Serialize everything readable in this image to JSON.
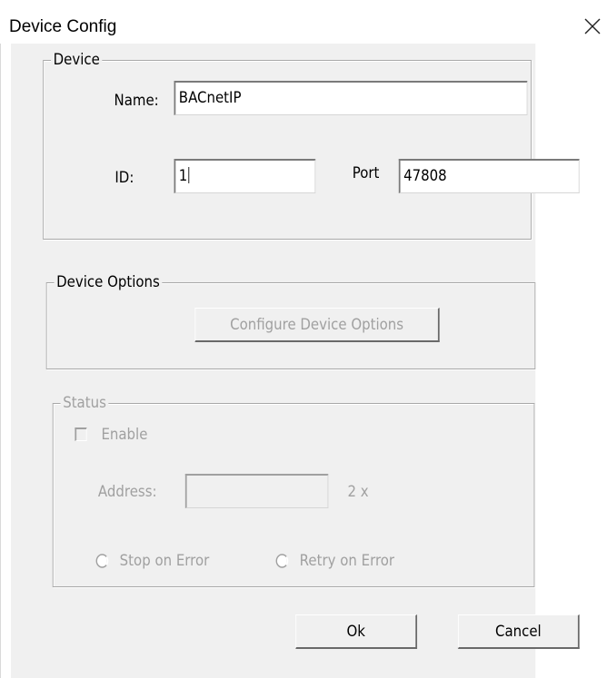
{
  "window": {
    "title": "Device Config",
    "close_icon": "close-icon"
  },
  "device_group": {
    "legend": "Device",
    "name_label": "Name:",
    "name_value": "BACnetIP",
    "id_label": "ID:",
    "id_value": "1",
    "port_label": "Port",
    "port_value": "47808"
  },
  "device_options_group": {
    "legend": "Device Options",
    "configure_button": "Configure Device Options"
  },
  "status_group": {
    "legend": "Status",
    "enable_label": "Enable",
    "enable_checked": false,
    "address_label": "Address:",
    "address_value": "",
    "address_suffix": "2 x",
    "stop_on_error_label": "Stop on Error",
    "retry_on_error_label": "Retry on Error"
  },
  "buttons": {
    "ok": "Ok",
    "cancel": "Cancel"
  },
  "colors": {
    "dialog_bg": "#f0f0f0",
    "disabled_text": "#a0a0a0",
    "group_border": "#a8a8a8"
  }
}
